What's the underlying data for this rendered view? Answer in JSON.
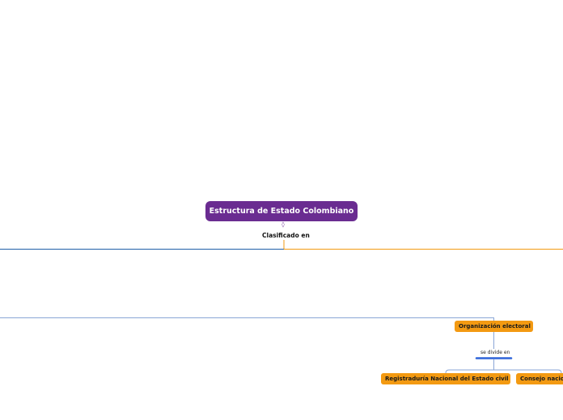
{
  "diagram": {
    "root": {
      "label": "Estructura de Estado Colombiano",
      "color": "#6a2c91"
    },
    "root_link_label": "Clasificado en",
    "branch_colors": {
      "left": "#1f5fa8",
      "right": "#f39a12",
      "sub": "#8aa6d6",
      "divider": "#2e63d9"
    },
    "nodes": {
      "organizacion_electoral": "Organización electoral",
      "divide_label": "se divide en",
      "registraduria": "Registraduría Nacional del Estado civil",
      "consejo": "Consejo nacional electoral"
    },
    "node_color": "#f39a12"
  }
}
